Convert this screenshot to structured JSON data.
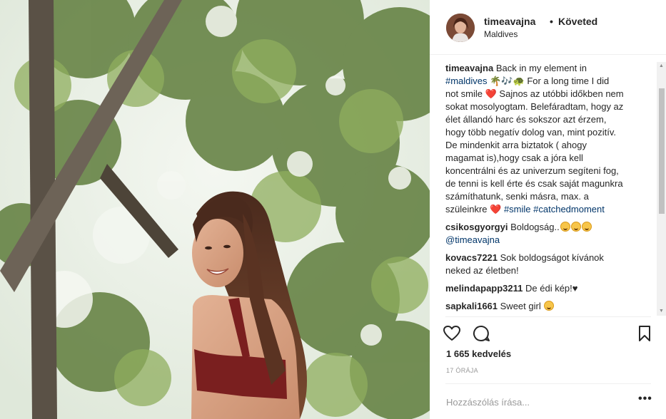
{
  "post": {
    "username": "timeavajna",
    "dot": "•",
    "follow_label": "Követed",
    "location": "Maldives",
    "caption": {
      "username": "timeavajna",
      "lines": [
        [
          "Back in my element in"
        ],
        [
          "#maldives",
          " 🌴🎶🐢 For a long time I did"
        ],
        [
          "not smile ❤️ Sajnos az utóbbi időkben nem"
        ],
        [
          "sokat mosolyogtam. Belefáradtam, hogy az"
        ],
        [
          "élet állandó harc és sokszor azt érzem,"
        ],
        [
          "hogy több negatív dolog van, mint pozitív."
        ],
        [
          "De mindenkit arra biztatok ( ahogy"
        ],
        [
          "magamat is),hogy csak a jóra kell"
        ],
        [
          "koncentrálni és az univerzum segíteni fog,"
        ],
        [
          "de tenni is kell érte és csak saját magunkra"
        ],
        [
          "számíthatunk, senki másra, max. a"
        ],
        [
          "szüleinkre ❤️ ",
          "#smile",
          " ",
          "#catchedmoment"
        ]
      ],
      "line1": "Back in my element in",
      "line2_tag": "#maldives",
      "line2_rest": " 🌴🎶🐢  For a long time I did",
      "line3": "not smile ❤️ Sajnos az utóbbi időkben nem",
      "line4": "sokat mosolyogtam. Belefáradtam, hogy az",
      "line5": "élet állandó harc és sokszor azt érzem,",
      "line6": "hogy több negatív dolog van, mint pozitív.",
      "line7": "De mindenkit arra biztatok ( ahogy",
      "line8": "magamat is),hogy csak a jóra kell",
      "line9": "koncentrálni és az univerzum segíteni fog,",
      "line10": "de tenni is kell érte és csak saját magunkra",
      "line11": "számíthatunk, senki másra, max. a",
      "line12_start": "szüleinkre ❤️ ",
      "tag_smile": "#smile",
      "tag_catched": "#catchedmoment"
    },
    "comments": [
      {
        "username": "csikosgyorgyi",
        "text": "Boldogság..",
        "mention": "@timeavajna",
        "emoji_count": 3
      },
      {
        "username": "kovacs7221",
        "text": "Sok boldogságot kívánok",
        "text2": "neked az életben!"
      },
      {
        "username": "melindapapp3211",
        "text": "De édi kép!♥"
      },
      {
        "username": "sapkali1661",
        "text": "Sweet girl",
        "emoji_count": 1
      }
    ],
    "likes": "1 665 kedvelés",
    "timestamp": "17 ÓRÁJA",
    "comment_placeholder": "Hozzászólás írása...",
    "more_label": "•••"
  },
  "icons": {
    "like": "heart-icon",
    "comment": "comment-bubble-icon",
    "save": "bookmark-icon",
    "more": "more-options-icon"
  },
  "colors": {
    "text": "#262626",
    "hashtag": "#003569",
    "muted": "#999999",
    "border": "#efefef"
  }
}
